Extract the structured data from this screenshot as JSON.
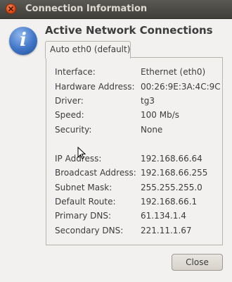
{
  "window": {
    "title": "Connection Information"
  },
  "heading": "Active Network Connections",
  "tab": {
    "label": "Auto eth0 (default)"
  },
  "details": [
    {
      "label": "Interface:",
      "value": "Ethernet (eth0)"
    },
    {
      "label": "Hardware Address:",
      "value": "00:26:9E:3A:4C:9C"
    },
    {
      "label": "Driver:",
      "value": "tg3"
    },
    {
      "label": "Speed:",
      "value": "100 Mb/s"
    },
    {
      "label": "Security:",
      "value": "None"
    }
  ],
  "ip_details": [
    {
      "label": "IP Address:",
      "value": "192.168.66.64"
    },
    {
      "label": "Broadcast Address:",
      "value": "192.168.66.255"
    },
    {
      "label": "Subnet Mask:",
      "value": "255.255.255.0"
    },
    {
      "label": "Default Route:",
      "value": "192.168.66.1"
    },
    {
      "label": "Primary DNS:",
      "value": "61.134.1.4"
    },
    {
      "label": "Secondary DNS:",
      "value": "221.11.1.67"
    }
  ],
  "buttons": {
    "close_label": "Close"
  },
  "icons": {
    "info": "info-icon",
    "close": "close-icon"
  },
  "colors": {
    "titlebar": "#4c4b47",
    "close_button": "#e05a22",
    "info_icon": "#3f74c6"
  }
}
